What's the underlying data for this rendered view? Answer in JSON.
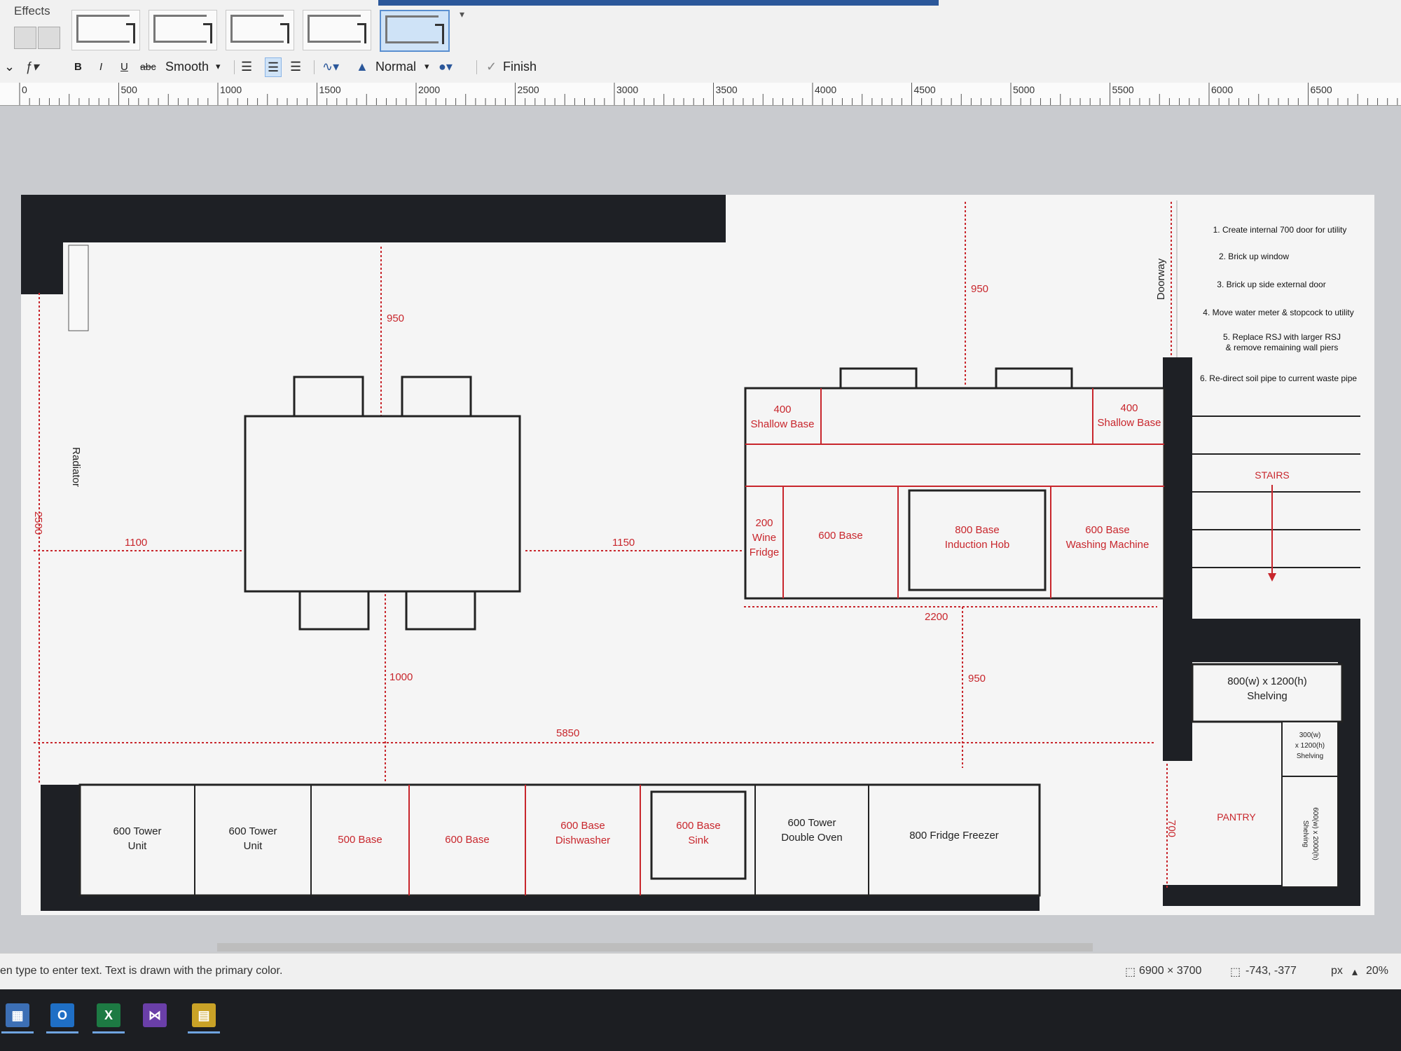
{
  "ribbon": {
    "effects_label": "Effects",
    "text_style": "Smooth",
    "bold": "B",
    "italic": "I",
    "underline": "U",
    "strike": "abc",
    "fill_mode": "Normal",
    "finish_label": "Finish"
  },
  "ruler": {
    "labels": [
      "0",
      "500",
      "1000",
      "1500",
      "2000",
      "2500",
      "3000",
      "3500",
      "4000",
      "4500",
      "5000",
      "5500",
      "6000",
      "6500"
    ]
  },
  "plan": {
    "radiator": "Radiator",
    "doorway": "Doorway",
    "stairs": "STAIRS",
    "pantry": "PANTRY",
    "dims": {
      "d950_left": "950",
      "d950_top": "950",
      "d950_right": "950",
      "d2500": "2500",
      "d1100": "1100",
      "d1150": "1150",
      "d1000": "1000",
      "d2200": "2200",
      "d5850": "5850",
      "d700": "700"
    },
    "island": {
      "shallow_left": "400\nShallow Base",
      "shallow_right": "400\nShallow Base",
      "wine_fridge": "200\nWine\nFridge",
      "base600": "600 Base",
      "hob": "800 Base\nInduction Hob",
      "washer": "600 Base\nWashing Machine"
    },
    "back_run": {
      "tower1": "600 Tower\nUnit",
      "tower2": "600 Tower\nUnit",
      "base500": "500 Base",
      "base600": "600 Base",
      "dishwasher": "600 Base\nDishwasher",
      "sink": "600 Base\nSink",
      "oven": "600 Tower\nDouble Oven",
      "fridge": "800 Fridge Freezer"
    },
    "shelving": {
      "main": "800(w) x 1200(h)\nShelving",
      "small": "300(w)\nx 1200(h)\nShelving",
      "tall": "600(w) x 2000(h)\nShelving"
    },
    "notes": [
      "1. Create internal 700 door for utility",
      "2. Brick up window",
      "3. Brick up side external door",
      "4. Move water meter & stopcock to utility",
      "5. Replace RSJ with larger RSJ\n& remove remaining wall piers",
      "6. Re-direct soil pipe to current waste pipe"
    ]
  },
  "status": {
    "hint": "en type to enter text. Text is drawn with the primary color.",
    "canvas_size": "6900 × 3700",
    "cursor": "-743, -377",
    "unit": "px",
    "zoom": "20%"
  },
  "colors": {
    "accent": "#2b579a",
    "plan_red": "#c8262c",
    "wall": "#1e2025"
  }
}
